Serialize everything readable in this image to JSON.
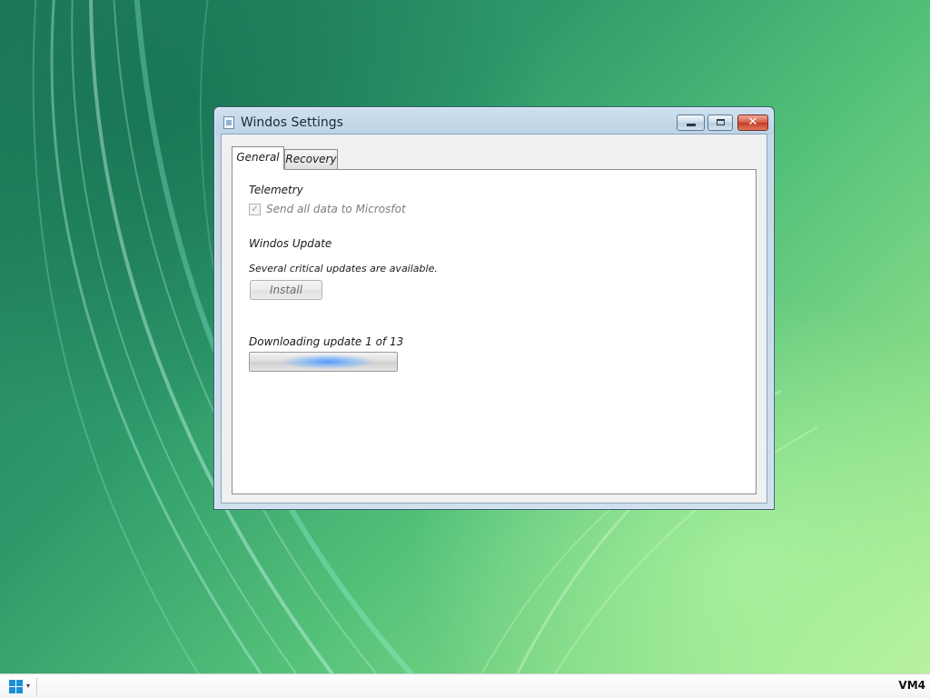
{
  "window": {
    "title": "Windos Settings",
    "title_icon": "window-app-icon",
    "controls": {
      "minimize_icon": "minimize-icon",
      "maximize_icon": "maximize-icon",
      "close_glyph": "✕"
    }
  },
  "tabs": [
    {
      "label": "General",
      "selected": true
    },
    {
      "label": "Recovery",
      "selected": false
    }
  ],
  "general": {
    "telemetry_heading": "Telemetry",
    "checkbox_label": "Send all data to Microsfot",
    "checkbox_checked": true,
    "checkbox_glyph": "✓",
    "update_heading": "Windos Update",
    "update_status": "Several critical updates are available.",
    "install_label": "Install",
    "download_label": "Downloading update 1 of 13",
    "progress_indeterminate": true
  },
  "taskbar": {
    "start_icon": "windows-logo-icon",
    "start_arrow": "▾",
    "vm_label": "VM4"
  },
  "colors": {
    "desktop_green": "#3fae6e",
    "accent_blue": "#1b8fd8",
    "close_red": "#c43c26"
  }
}
